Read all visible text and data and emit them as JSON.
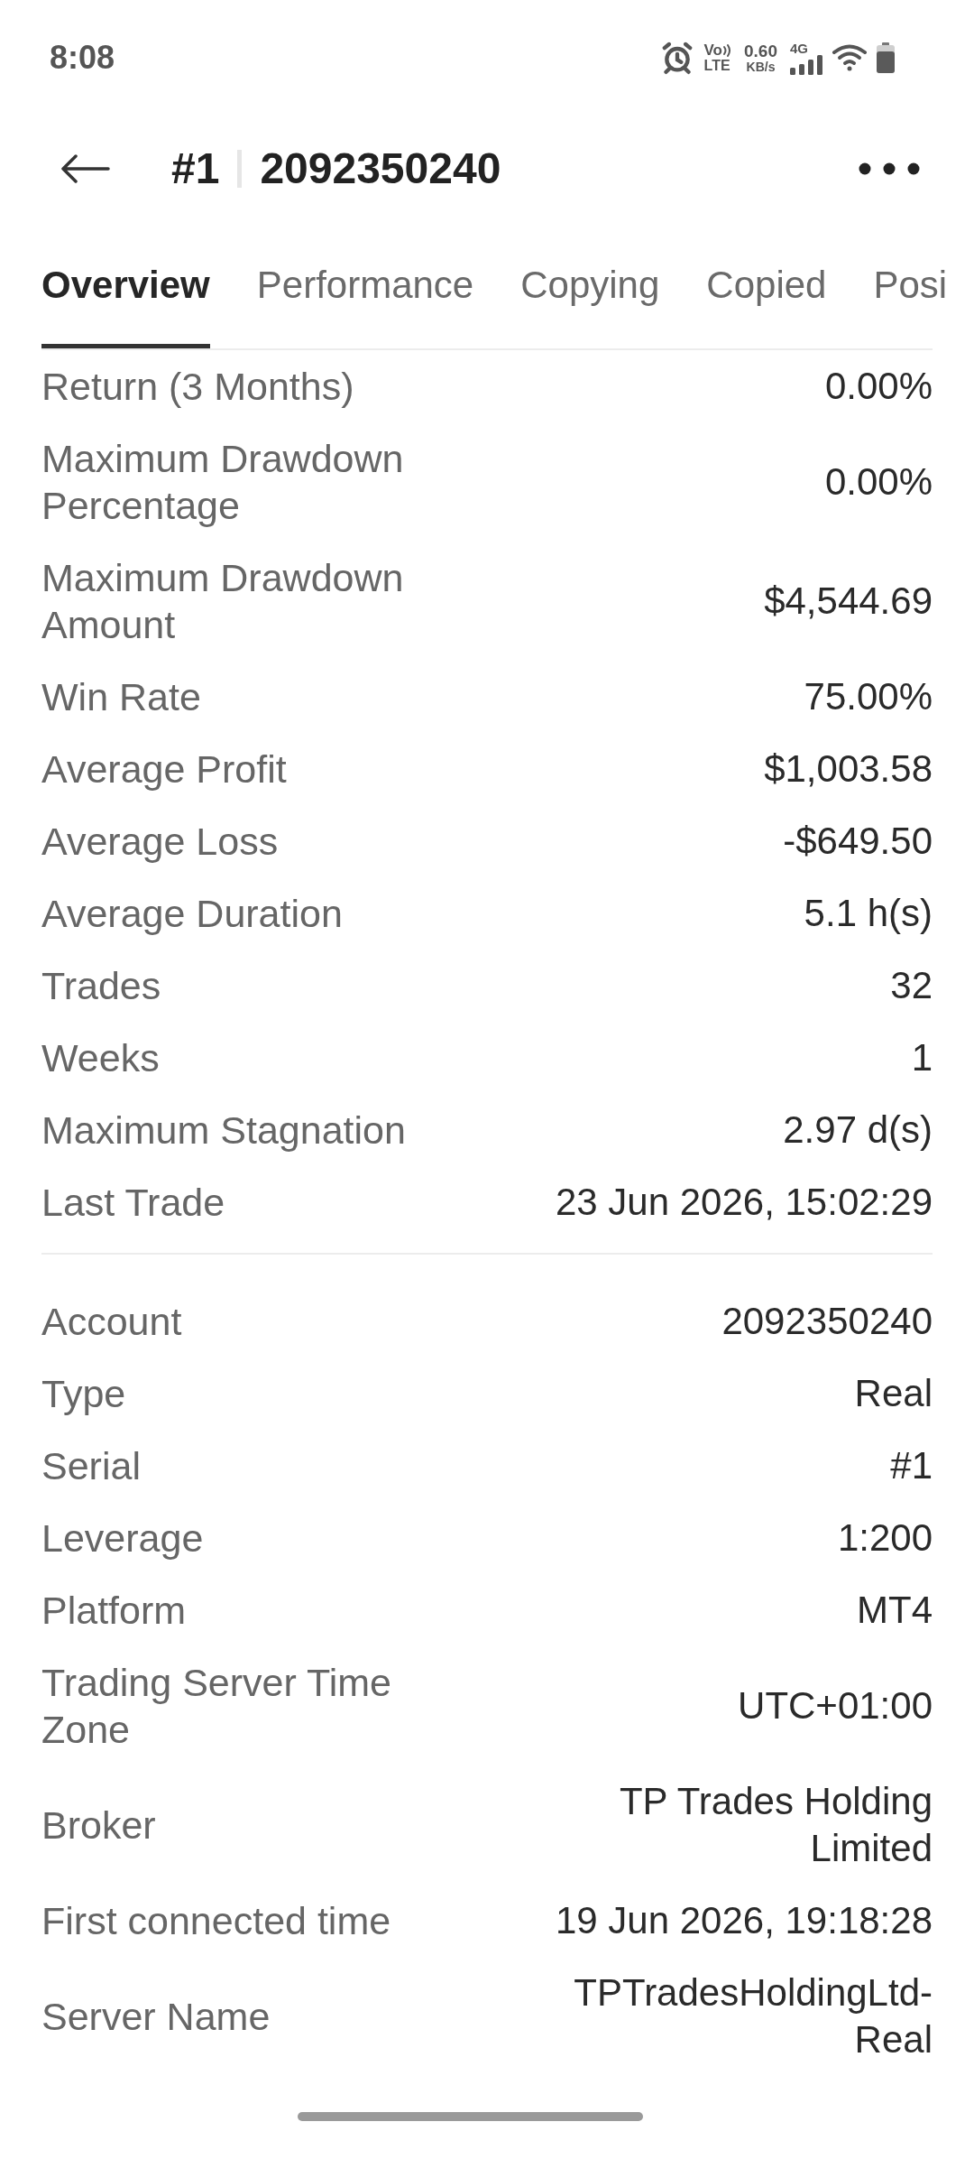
{
  "status_bar": {
    "time": "8:08",
    "volte": {
      "top": "Vo",
      "bottom": "LTE"
    },
    "speed": {
      "value": "0.60",
      "unit": "KB/s"
    },
    "network": "4G"
  },
  "header": {
    "serial": "#1",
    "account": "2092350240"
  },
  "tabs": [
    {
      "label": "Overview",
      "selected": true
    },
    {
      "label": "Performance",
      "selected": false
    },
    {
      "label": "Copying",
      "selected": false
    },
    {
      "label": "Copied",
      "selected": false
    },
    {
      "label": "Posi",
      "selected": false
    }
  ],
  "sections": [
    {
      "rows": [
        {
          "label": "Return (3 Months)",
          "value": "0.00%"
        },
        {
          "label": "Maximum Drawdown Percentage",
          "value": "0.00%"
        },
        {
          "label": "Maximum Drawdown Amount",
          "value": "$4,544.69"
        },
        {
          "label": "Win Rate",
          "value": "75.00%"
        },
        {
          "label": "Average Profit",
          "value": "$1,003.58"
        },
        {
          "label": "Average Loss",
          "value": "-$649.50"
        },
        {
          "label": "Average Duration",
          "value": "5.1 h(s)"
        },
        {
          "label": "Trades",
          "value": "32"
        },
        {
          "label": "Weeks",
          "value": "1"
        },
        {
          "label": "Maximum Stagnation",
          "value": "2.97 d(s)"
        },
        {
          "label": "Last Trade",
          "value": "23 Jun 2026, 15:02:29"
        }
      ]
    },
    {
      "rows": [
        {
          "label": "Account",
          "value": "2092350240"
        },
        {
          "label": "Type",
          "value": "Real"
        },
        {
          "label": "Serial",
          "value": "#1"
        },
        {
          "label": "Leverage",
          "value": "1:200"
        },
        {
          "label": "Platform",
          "value": "MT4"
        },
        {
          "label": "Trading Server Time Zone",
          "value": "UTC+01:00"
        },
        {
          "label": "Broker",
          "value": "TP Trades Holding Limited"
        },
        {
          "label": "First connected time",
          "value": "19 Jun 2026, 19:18:28"
        },
        {
          "label": "Server Name",
          "value": "TPTradesHoldingLtd-Real"
        }
      ]
    }
  ]
}
